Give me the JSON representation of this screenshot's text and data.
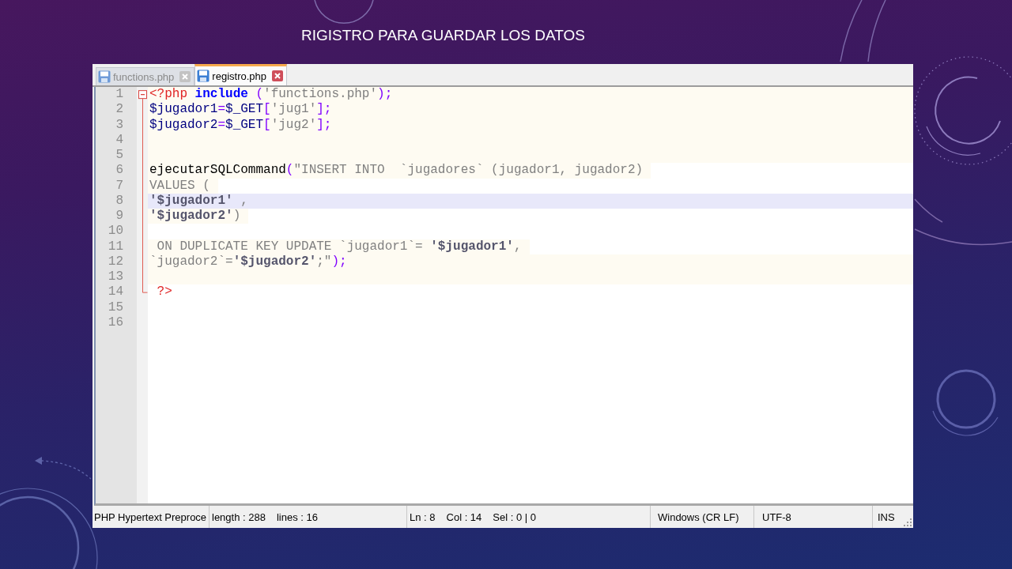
{
  "slide": {
    "title": "RIGISTRO PARA GUARDAR LOS DATOS"
  },
  "editor": {
    "tabs": [
      {
        "label": "functions.php",
        "selected": false
      },
      {
        "label": "registro.php",
        "selected": true
      }
    ],
    "lines": [
      {
        "number": "1",
        "selected": false,
        "kind": "band",
        "expanded": true,
        "tokens": [
          {
            "text": "<?php",
            "kind": "tag"
          },
          {
            "text": " include",
            "kind": "keyword"
          },
          {
            "text": " (",
            "kind": "operator"
          },
          {
            "text": "'functions.php'",
            "kind": "string"
          },
          {
            "text": ");",
            "kind": "operator"
          }
        ],
        "children": [
          {
            "number": "2",
            "selected": false,
            "kind": "band",
            "tokens": [
              {
                "text": "$jugador1",
                "kind": "variable"
              },
              {
                "text": "=",
                "kind": "operator"
              },
              {
                "text": "$_GET",
                "kind": "variable"
              },
              {
                "text": "[",
                "kind": "operator"
              },
              {
                "text": "'jug1'",
                "kind": "string"
              },
              {
                "text": "];",
                "kind": "operator"
              }
            ]
          },
          {
            "number": "3",
            "selected": false,
            "kind": "band",
            "tokens": [
              {
                "text": "$jugador2",
                "kind": "variable"
              },
              {
                "text": "=",
                "kind": "operator"
              },
              {
                "text": "$_GET",
                "kind": "variable"
              },
              {
                "text": "[",
                "kind": "operator"
              },
              {
                "text": "'jug2'",
                "kind": "string"
              },
              {
                "text": "];",
                "kind": "operator"
              }
            ]
          },
          {
            "number": "4",
            "selected": false,
            "kind": "band"
          },
          {
            "number": "5",
            "selected": false,
            "kind": "band"
          },
          {
            "number": "6",
            "selected": false,
            "kind": "inline",
            "tokens": [
              {
                "text": "ejecutarSQLCommand",
                "kind": "plain"
              },
              {
                "text": "(",
                "kind": "operator"
              },
              {
                "text": "\"INSERT INTO  `jugadores` (jugador1, jugador2)",
                "kind": "string"
              }
            ]
          },
          {
            "number": "7",
            "selected": false,
            "kind": "inline",
            "tokens": [
              {
                "text": "VALUES (",
                "kind": "string"
              }
            ]
          },
          {
            "number": "8",
            "selected": true,
            "kind": "plain",
            "tokens": [
              {
                "text": "'$jugador1'",
                "kind": "interp"
              },
              {
                "text": " ,",
                "kind": "string"
              }
            ]
          },
          {
            "number": "9",
            "selected": false,
            "kind": "inline",
            "tokens": [
              {
                "text": "'$jugador2'",
                "kind": "interp"
              },
              {
                "text": ")",
                "kind": "string"
              }
            ]
          },
          {
            "number": "10",
            "selected": false,
            "kind": "plain"
          },
          {
            "number": "11",
            "selected": false,
            "kind": "inline",
            "tokens": [
              {
                "text": " ON DUPLICATE KEY UPDATE `jugador1`= ",
                "kind": "string"
              },
              {
                "text": "'$jugador1'",
                "kind": "interp"
              },
              {
                "text": ",",
                "kind": "string"
              }
            ]
          },
          {
            "number": "12",
            "selected": false,
            "kind": "band",
            "tokens": [
              {
                "text": "`jugador2`=",
                "kind": "string"
              },
              {
                "text": "'$jugador2'",
                "kind": "interp"
              },
              {
                "text": ";\"",
                "kind": "string"
              },
              {
                "text": ");",
                "kind": "operator"
              }
            ]
          },
          {
            "number": "13",
            "selected": false,
            "kind": "band"
          },
          {
            "number": "14",
            "selected": false,
            "kind": "plain",
            "tokens": [
              {
                "text": " ?>",
                "kind": "tag"
              }
            ]
          }
        ]
      },
      {
        "number": "15",
        "selected": false,
        "kind": "plain"
      },
      {
        "number": "16",
        "selected": false,
        "kind": "plain"
      }
    ],
    "status_bar": [
      {
        "texts": [
          "PHP Hypertext Preproce"
        ]
      },
      {
        "texts": [
          "length : 288",
          "lines : 16"
        ]
      },
      {
        "texts": [
          "Ln : 8",
          "Col : 14",
          "Sel : 0 | 0"
        ]
      },
      {
        "texts": [
          "Windows (CR LF)"
        ]
      },
      {
        "texts": [
          "UTF-8"
        ]
      },
      {
        "texts": [
          "INS"
        ]
      }
    ]
  }
}
